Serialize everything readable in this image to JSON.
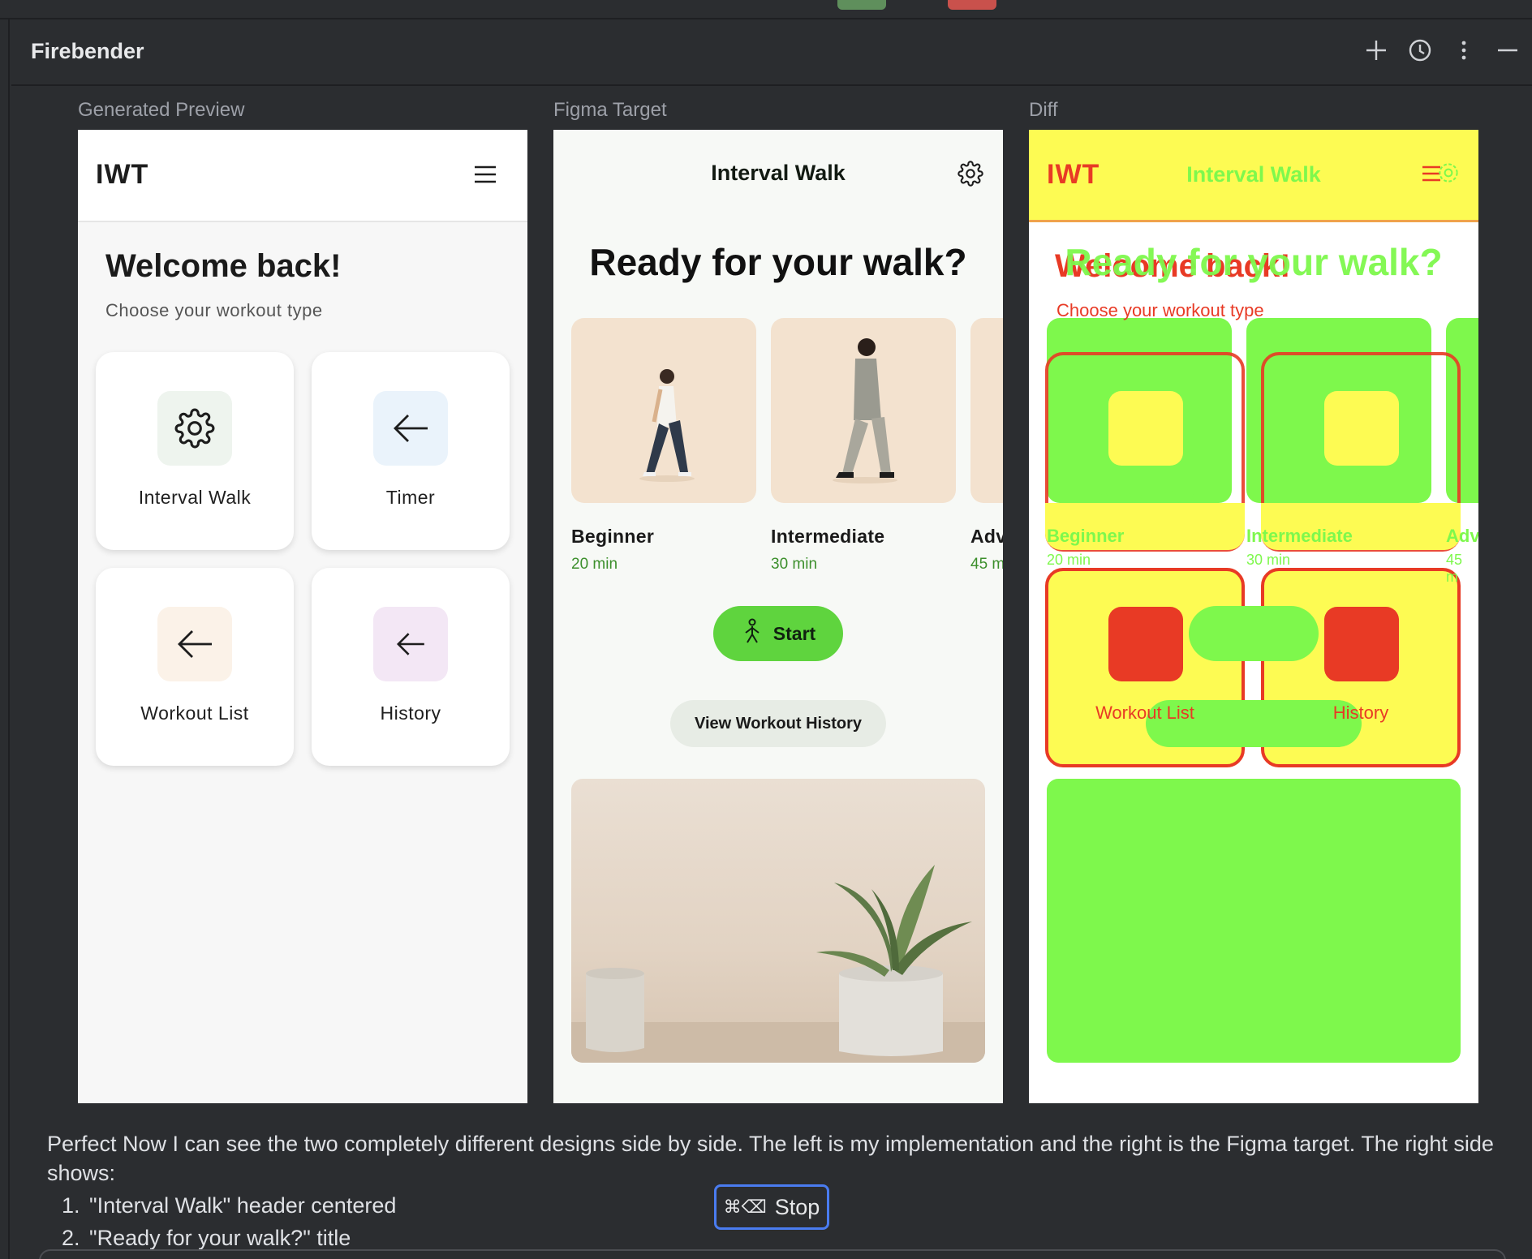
{
  "tool": {
    "title": "Firebender",
    "actions": [
      "plus-icon",
      "history-icon",
      "more-vert-icon",
      "minimize-icon"
    ]
  },
  "captions": {
    "preview": "Generated Preview",
    "figma": "Figma Target",
    "diff": "Diff"
  },
  "preview": {
    "brand": "IWT",
    "welcome": "Welcome back!",
    "subtitle": "Choose your workout type",
    "tiles": [
      {
        "label": "Interval Walk",
        "icon": "gear-icon",
        "tint": "#eef4ee"
      },
      {
        "label": "Timer",
        "icon": "arrow-left-icon",
        "tint": "#eaf3fb"
      },
      {
        "label": "Workout List",
        "icon": "arrow-left-icon",
        "tint": "#fbf2e8"
      },
      {
        "label": "History",
        "icon": "arrow-left-icon",
        "tint": "#f3e7f5"
      }
    ]
  },
  "figma": {
    "header": "Interval Walk",
    "title": "Ready for your walk?",
    "levels": [
      {
        "name": "Beginner",
        "duration": "20 min"
      },
      {
        "name": "Intermediate",
        "duration": "30 min"
      },
      {
        "name": "Adv",
        "duration": "45 m"
      }
    ],
    "start_label": "Start",
    "history_label": "View Workout History"
  },
  "diff": {
    "brand": "IWT",
    "header": "Interval Walk",
    "title_target": "Ready for your walk?",
    "title_preview": "Welcome back!",
    "subtitle": "Choose your workout type",
    "tile_labels": [
      "Interval Walk",
      "Timer",
      "Workout List",
      "History"
    ],
    "levels": [
      "Beginner",
      "Intermediate",
      "Adv"
    ],
    "durations": [
      "20 min",
      "30 min",
      "45 m"
    ]
  },
  "chat": {
    "message": "Perfect Now I can see the two completely different designs side by side. The left is my implementation and the right is the Figma target. The right side shows:",
    "points": [
      {
        "num": "1.",
        "text": "\"Interval Walk\" header centered"
      },
      {
        "num": "2.",
        "text": "\"Ready for your walk?\" title"
      }
    ],
    "stop_shortcut": "⌘⌫",
    "stop_label": "Stop"
  },
  "colors": {
    "accent_green": "#5fd43e",
    "diff_green": "#7ef84c",
    "diff_yellow": "#fdfb53",
    "diff_red": "#e83a25",
    "focus_blue": "#4a7cf0"
  }
}
